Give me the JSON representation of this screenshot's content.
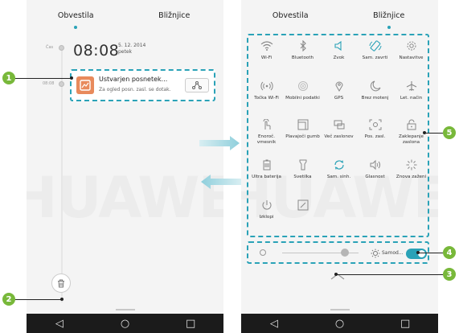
{
  "left_screen": {
    "tabs": [
      {
        "label": "Obvestila",
        "active": true
      },
      {
        "label": "Bližnjice",
        "active": false
      }
    ],
    "timeline": {
      "now_label": "Čas",
      "notif_time": "08:08"
    },
    "clock": {
      "time": "08:08",
      "date": "5. 12. 2014",
      "weekday": "petek"
    },
    "notification": {
      "title": "Ustvarjen posnetek...",
      "subtitle": "Za ogled posn. zasl. se dotak.",
      "icon": "screenshot-icon",
      "action_icon": "share-icon"
    },
    "trash_icon": "trash-icon"
  },
  "right_screen": {
    "tabs": [
      {
        "label": "Obvestila",
        "active": false
      },
      {
        "label": "Bližnjice",
        "active": true
      }
    ],
    "toggles": [
      {
        "label": "Wi-Fi",
        "icon": "wifi-icon",
        "active": false
      },
      {
        "label": "Bluetooth",
        "icon": "bluetooth-icon",
        "active": false
      },
      {
        "label": "Zvok",
        "icon": "sound-icon",
        "active": true
      },
      {
        "label": "Sam. zavrti",
        "icon": "auto-rotate-icon",
        "active": true
      },
      {
        "label": "Nastavitve",
        "icon": "settings-icon",
        "active": false
      },
      {
        "label": "Točka Wi-Fi",
        "icon": "hotspot-icon",
        "active": false
      },
      {
        "label": "Mobilni podatki",
        "icon": "mobile-data-icon",
        "active": false
      },
      {
        "label": "GPS",
        "icon": "gps-icon",
        "active": false
      },
      {
        "label": "Brez motenj",
        "icon": "do-not-disturb-icon",
        "active": false
      },
      {
        "label": "Let. način",
        "icon": "airplane-icon",
        "active": false
      },
      {
        "label": "Enoroč. vmesnik",
        "icon": "one-hand-icon",
        "active": false
      },
      {
        "label": "Plavajoči gumb",
        "icon": "floating-button-icon",
        "active": false
      },
      {
        "label": "Več zaslonov",
        "icon": "multi-screen-icon",
        "active": false
      },
      {
        "label": "Pos. zasl.",
        "icon": "screenshot-icon",
        "active": false
      },
      {
        "label": "Zaklepanje zaslona",
        "icon": "lock-screen-icon",
        "active": false
      },
      {
        "label": "Ultra baterija",
        "icon": "battery-icon",
        "active": false
      },
      {
        "label": "Svetilka",
        "icon": "flashlight-icon",
        "active": false
      },
      {
        "label": "Sam. sinh.",
        "icon": "sync-icon",
        "active": true
      },
      {
        "label": "Glasnost",
        "icon": "volume-icon",
        "active": false
      },
      {
        "label": "Znova zaženi",
        "icon": "restart-icon",
        "active": false
      },
      {
        "label": "Izklopi",
        "icon": "power-icon",
        "active": false
      },
      {
        "label": "",
        "icon": "edit-icon",
        "active": false
      }
    ],
    "brightness": {
      "auto_label": "Samod...",
      "level": 0.82,
      "auto_enabled": true
    },
    "collapse_icon": "chevron-up-icon"
  },
  "nav_buttons": [
    {
      "glyph": "◁",
      "icon": "back-icon"
    },
    {
      "glyph": "○",
      "icon": "home-icon"
    },
    {
      "glyph": "□",
      "icon": "recent-apps-icon"
    }
  ],
  "callouts": [
    "1",
    "2",
    "3",
    "4",
    "5"
  ],
  "colors": {
    "accent": "#2aa2b7",
    "callout": "#78b83a",
    "notif_icon": "#e88a5c",
    "navbar": "#1b1b1b"
  }
}
